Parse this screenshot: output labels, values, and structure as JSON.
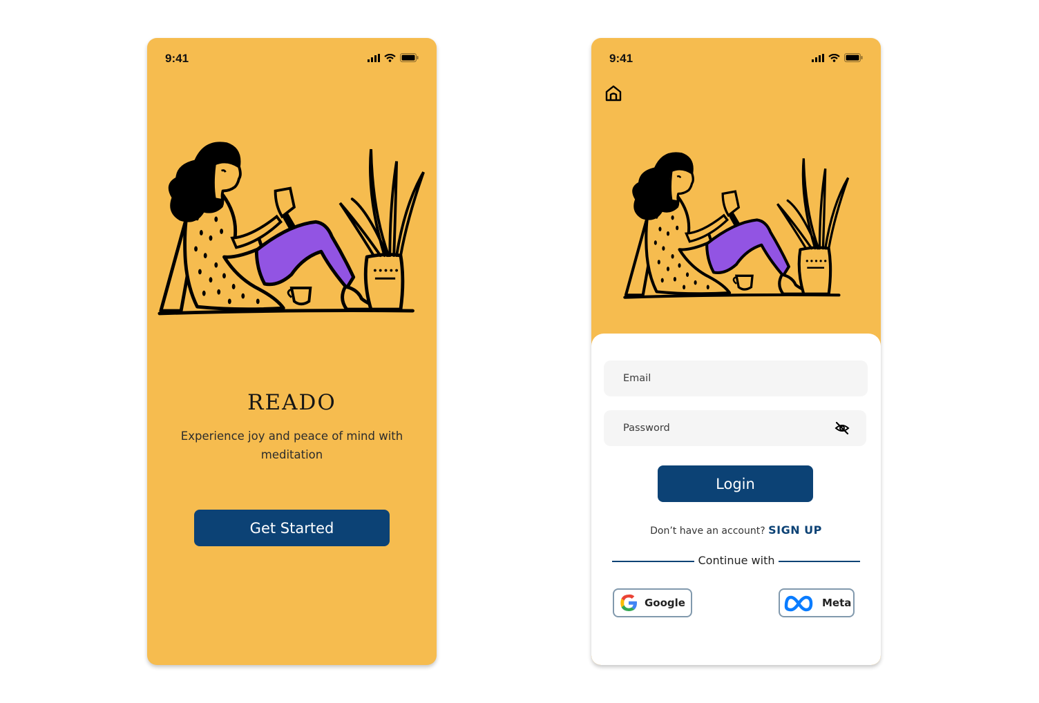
{
  "status_bar": {
    "time": "9:41"
  },
  "welcome": {
    "title": "READO",
    "tagline": "Experience joy and  peace of mind with meditation",
    "cta_label": "Get Started"
  },
  "login": {
    "email_placeholder": "Email",
    "password_placeholder": "Password",
    "login_label": "Login",
    "signup_prompt": "Don’t have an account?",
    "signup_label": "SIGN UP",
    "continue_with": "Continue with",
    "google_label": "Google",
    "meta_label": "Meta"
  },
  "colors": {
    "background": "#F6BC4F",
    "primary": "#0C4275",
    "pants": "#9254E3",
    "field": "#F5F5F5"
  }
}
